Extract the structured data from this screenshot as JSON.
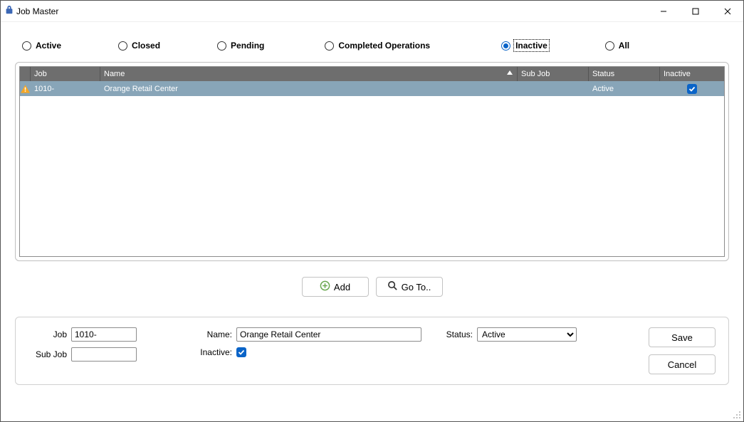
{
  "window": {
    "title": "Job Master"
  },
  "filters": {
    "active": {
      "label": "Active",
      "selected": false
    },
    "closed": {
      "label": "Closed",
      "selected": false
    },
    "pending": {
      "label": "Pending",
      "selected": false
    },
    "completed": {
      "label": "Completed Operations",
      "selected": false
    },
    "inactive": {
      "label": "Inactive",
      "selected": true
    },
    "all": {
      "label": "All",
      "selected": false
    }
  },
  "grid": {
    "headers": {
      "job": "Job",
      "name": "Name",
      "sub": "Sub Job",
      "status": "Status",
      "inactive": "Inactive"
    },
    "rows": [
      {
        "job": "1010-",
        "name": "Orange Retail Center",
        "sub": "",
        "status": "Active",
        "inactive": true
      }
    ]
  },
  "buttons": {
    "add": "Add",
    "goto": "Go To..",
    "save": "Save",
    "cancel": "Cancel"
  },
  "form": {
    "labels": {
      "job": "Job",
      "subjob": "Sub Job",
      "name": "Name:",
      "inactive": "Inactive:",
      "status": "Status:"
    },
    "values": {
      "job": "1010-",
      "subjob": "",
      "name": "Orange Retail Center",
      "inactive": true
    },
    "status": {
      "selected": "Active"
    }
  }
}
